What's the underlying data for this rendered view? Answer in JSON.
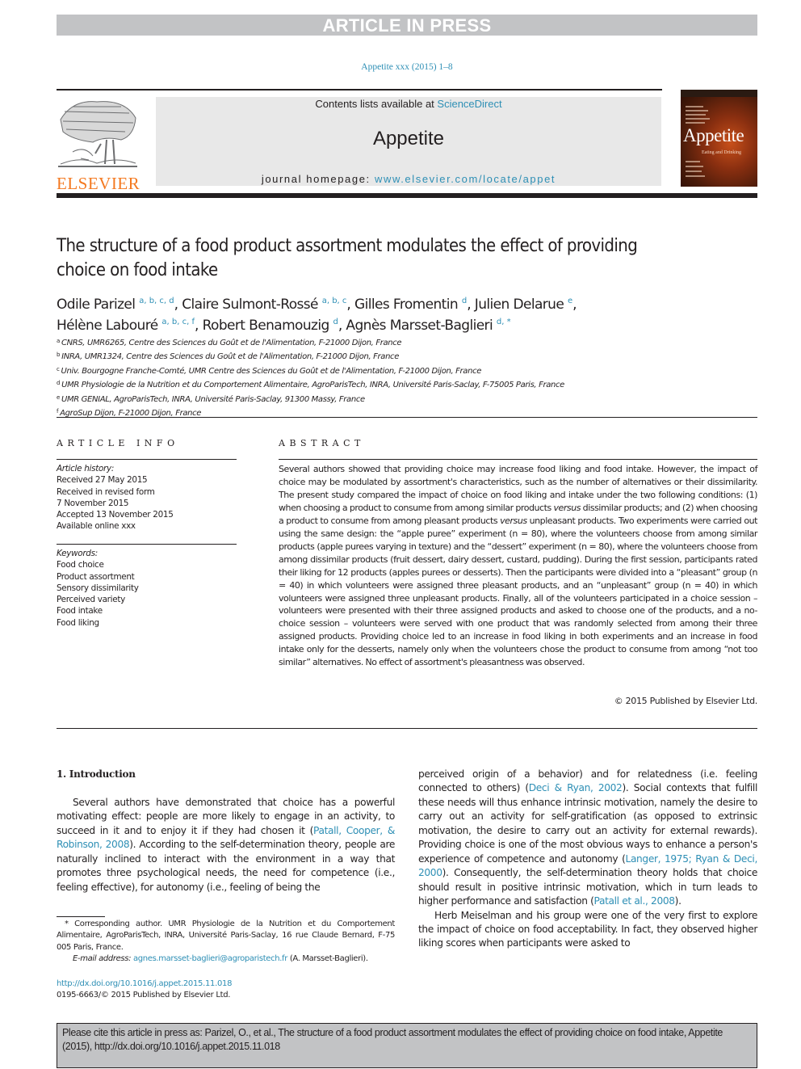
{
  "banner": {
    "text": "ARTICLE IN PRESS"
  },
  "journal_ref": "Appetite xxx (2015) 1–8",
  "masthead": {
    "publisher_logo_text": "ELSEVIER",
    "contents_prefix": "Contents lists available at ",
    "contents_link": "ScienceDirect",
    "journal_name": "Appetite",
    "homepage_prefix": "journal homepage: ",
    "homepage_link": "www.elsevier.com/locate/appet",
    "cover_title": "Appetite",
    "cover_subtitle": "Eating and Drinking"
  },
  "article": {
    "title": "The structure of a food product assortment modulates the effect of providing choice on food intake",
    "authors": [
      {
        "name": "Odile Parizel",
        "affils": "a, b, c, d",
        "sep": ", "
      },
      {
        "name": "Claire Sulmont-Rossé",
        "affils": "a, b, c",
        "sep": ", "
      },
      {
        "name": "Gilles Fromentin",
        "affils": "d",
        "sep": ", "
      },
      {
        "name": "Julien Delarue",
        "affils": "e",
        "sep": ","
      },
      {
        "name": "Hélène Labouré",
        "affils": "a, b, c, f",
        "sep": ", "
      },
      {
        "name": "Robert Benamouzig",
        "affils": "d",
        "sep": ", "
      },
      {
        "name": "Agnès Marsset-Baglieri",
        "affils": "d, *",
        "sep": ""
      }
    ],
    "affiliations": [
      {
        "key": "a",
        "text": "CNRS, UMR6265, Centre des Sciences du Goût et de l'Alimentation, F-21000 Dijon, France"
      },
      {
        "key": "b",
        "text": "INRA, UMR1324, Centre des Sciences du Goût et de l'Alimentation, F-21000 Dijon, France"
      },
      {
        "key": "c",
        "text": "Univ. Bourgogne Franche-Comté, UMR Centre des Sciences du Goût et de l'Alimentation, F-21000 Dijon, France"
      },
      {
        "key": "d",
        "text": "UMR Physiologie de la Nutrition et du Comportement Alimentaire, AgroParisTech, INRA, Université Paris-Saclay, F-75005 Paris, France"
      },
      {
        "key": "e",
        "text": "UMR GENIAL, AgroParisTech, INRA, Université Paris-Saclay, 91300 Massy, France"
      },
      {
        "key": "f",
        "text": "AgroSup Dijon, F-21000 Dijon, France"
      }
    ]
  },
  "article_info": {
    "heading": "ARTICLE INFO",
    "history_label": "Article history:",
    "history": [
      "Received 27 May 2015",
      "Received in revised form",
      "7 November 2015",
      "Accepted 13 November 2015",
      "Available online xxx"
    ],
    "keywords_label": "Keywords:",
    "keywords": [
      "Food choice",
      "Product assortment",
      "Sensory dissimilarity",
      "Perceived variety",
      "Food intake",
      "Food liking"
    ]
  },
  "abstract": {
    "heading": "ABSTRACT",
    "p1": "Several authors showed that providing choice may increase food liking and food intake. However, the impact of choice may be modulated by assortment's characteristics, such as the number of alternatives or their dissimilarity. The present study compared the impact of choice on food liking and intake under the two following conditions: (1) when choosing a product to consume from among similar products ",
    "versus1": "versus",
    "p2": " dissimilar products; and (2) when choosing a product to consume from among pleasant products ",
    "versus2": "versus",
    "p3": " unpleasant products. Two experiments were carried out using the same design: the “apple puree” experiment (n = 80), where the volunteers choose from among similar products (apple purees varying in texture) and the “dessert” experiment (n = 80), where the volunteers choose from among dissimilar products (fruit dessert, dairy dessert, custard, pudding). During the first session, participants rated their liking for 12 products (apples purees or desserts). Then the participants were divided into a “pleasant” group (n = 40) in which volunteers were assigned three pleasant products, and an “unpleasant” group (n = 40) in which volunteers were assigned three unpleasant products. Finally, all of the volunteers participated in a choice session – volunteers were presented with their three assigned products and asked to choose one of the products, and a no-choice session – volunteers were served with one product that was randomly selected from among their three assigned products. Providing choice led to an increase in food liking in both experiments and an increase in food intake only for the desserts, namely only when the volunteers chose the product to consume from among “not too similar” alternatives. No effect of assortment's pleasantness was observed.",
    "copyright": "© 2015 Published by Elsevier Ltd."
  },
  "introduction": {
    "heading": "1.  Introduction",
    "left_p1_a": "Several authors have demonstrated that choice has a powerful motivating effect: people are more likely to engage in an activity, to succeed in it and to enjoy it if they had chosen it (",
    "left_p1_cite": "Patall, Cooper, & Robinson, 2008",
    "left_p1_b": "). According to the self-determination theory, people are naturally inclined to interact with the environment in a way that promotes three psychological needs, the need for competence (i.e., feeling effective), for autonomy (i.e., feeling of being the",
    "right_p1_a": "perceived origin of a behavior) and for relatedness (i.e. feeling connected to others) (",
    "right_p1_cite1": "Deci & Ryan, 2002",
    "right_p1_b": "). Social contexts that fulfill these needs will thus enhance intrinsic motivation, namely the desire to carry out an activity for self-gratification (as opposed to extrinsic motivation, the desire to carry out an activity for external rewards). Providing choice is one of the most obvious ways to enhance a person's experience of competence and autonomy (",
    "right_p1_cite2": "Langer, 1975; Ryan & Deci, 2000",
    "right_p1_c": "). Consequently, the self-determination theory holds that choice should result in positive intrinsic motivation, which in turn leads to higher performance and satisfaction (",
    "right_p1_cite3": "Patall et al., 2008",
    "right_p1_d": ").",
    "right_p2": "Herb Meiselman and his group were one of the very first to explore the impact of choice on food acceptability. In fact, they observed higher liking scores when participants were asked to"
  },
  "footnote": {
    "corresponding": "* Corresponding author. UMR Physiologie de la Nutrition et du Comportement Alimentaire, AgroParisTech, INRA, Université Paris-Saclay, 16 rue Claude Bernard, F-75 005 Paris, France.",
    "email_label": "E-mail address: ",
    "email": "agnes.marsset-baglieri@agroparistech.fr",
    "email_owner": " (A. Marsset-Baglieri).",
    "doi": "http://dx.doi.org/10.1016/j.appet.2015.11.018",
    "issn": "0195-6663/© 2015 Published by Elsevier Ltd."
  },
  "cite_box": {
    "text": "Please cite this article in press as: Parizel, O., et al., The structure of a food product assortment modulates the effect of providing choice on food intake, Appetite (2015), http://dx.doi.org/10.1016/j.appet.2015.11.018"
  }
}
